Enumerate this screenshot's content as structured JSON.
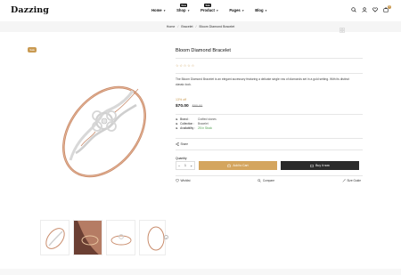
{
  "header": {
    "logo": "Dazzing",
    "nav": [
      {
        "label": "Home",
        "badge": "",
        "badge_color": ""
      },
      {
        "label": "Shop",
        "badge": "New",
        "badge_color": "#111111"
      },
      {
        "label": "Product",
        "badge": "Sale",
        "badge_color": "#111111"
      },
      {
        "label": "Pages",
        "badge": "",
        "badge_color": ""
      },
      {
        "label": "Blog",
        "badge": "",
        "badge_color": ""
      }
    ],
    "icons": [
      "search-icon",
      "user-icon",
      "heart-icon",
      "cart-icon"
    ],
    "cart_count": "0"
  },
  "breadcrumb": {
    "items": [
      "Home",
      "Bracelet",
      "Bloom Diamond Bracelet"
    ],
    "separator": "/"
  },
  "product": {
    "sale_badge": "Sale",
    "title": "Bloom Diamond Bracelet",
    "stars_filled": 0,
    "stars_total": 5,
    "description": "The Bloom Diamond Bracelet is an elegant accessory featuring a delicate single row of diamonds set in a gold setting. With its distinct classic look.",
    "discount": "13% off",
    "price": "$70.00",
    "old_price": "$80.00",
    "meta": [
      {
        "label": "Brand :",
        "value": "Crafted stones",
        "icon": "tag-icon"
      },
      {
        "label": "Collection :",
        "value": "Bracelet",
        "icon": "tag-icon"
      },
      {
        "label": "Availability :",
        "value": "25 In Stock",
        "icon": "check-icon"
      }
    ],
    "share_label": "Share",
    "quantity_label": "Quantity",
    "quantity_value": "1",
    "add_to_cart_label": "Add to Cart",
    "buy_now_label": "Buy it now",
    "actions": [
      {
        "label": "Wishlist",
        "icon": "heart-icon"
      },
      {
        "label": "Compare",
        "icon": "compare-icon"
      },
      {
        "label": "Size Guide",
        "icon": "ruler-icon"
      }
    ]
  },
  "colors": {
    "accent": "#c99a52",
    "dark_button": "#2b2b2b",
    "stock": "#4a9d4a"
  }
}
